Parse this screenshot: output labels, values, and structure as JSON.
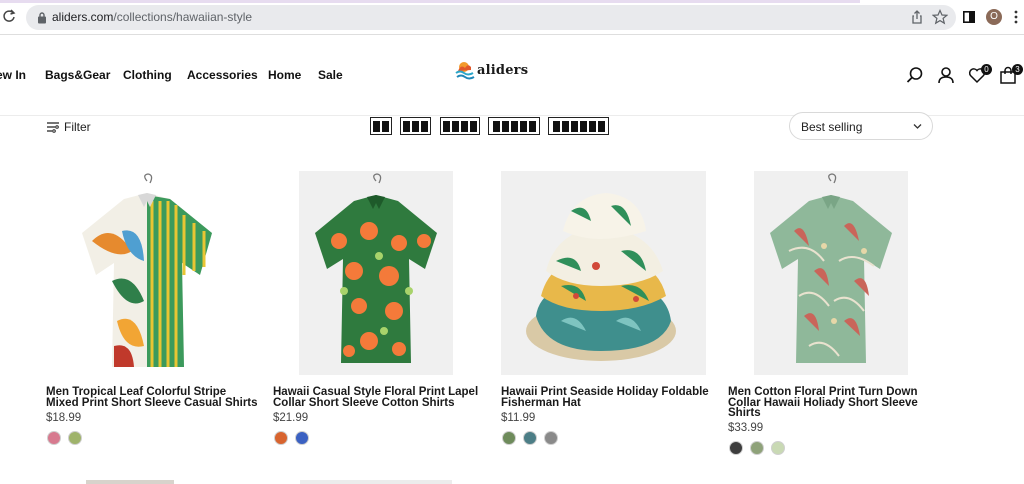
{
  "browser": {
    "url_domain": "aliders.com",
    "url_path": "/collections/hawaiian-style",
    "avatar_initial": "O"
  },
  "header": {
    "nav": [
      "ew In",
      "Bags&Gear",
      "Clothing",
      "Accessories",
      "Home",
      "Sale"
    ],
    "logo_text": "aliders",
    "wishlist_count": "0",
    "cart_count": "3"
  },
  "toolbar": {
    "filter_label": "Filter",
    "sort_label": "Best selling",
    "grid_options": [
      2,
      3,
      4,
      5,
      6
    ]
  },
  "products": [
    {
      "title_line1": "Men Tropical Leaf Colorful Stripe",
      "title_line2": "Mixed Print Short Sleeve Casual Shirts",
      "title_line3": "",
      "price": "$18.99",
      "swatch_colors": [
        "#d77a8f",
        "#9fb36b"
      ]
    },
    {
      "title_line1": "Hawaii Casual Style Floral Print Lapel",
      "title_line2": "Collar Short Sleeve Cotton Shirts",
      "title_line3": "",
      "price": "$21.99",
      "swatch_colors": [
        "#d8642f",
        "#3b61c2"
      ]
    },
    {
      "title_line1": "Hawaii Print Seaside Holiday Foldable",
      "title_line2": "Fisherman Hat",
      "title_line3": "",
      "price": "$11.99",
      "swatch_colors": [
        "#6e8b5b",
        "#4c7e86",
        "#8a8a8a"
      ]
    },
    {
      "title_line1": "Men Cotton Floral Print Turn Down",
      "title_line2": "Collar Hawaii Holiady Short Sleeve",
      "title_line3": "Shirts",
      "price": "$33.99",
      "swatch_colors": [
        "#3d3d3d",
        "#8fa27a",
        "#c9d9b4"
      ]
    }
  ],
  "colors": {
    "accent": "#111111",
    "image_bg": "#f0f0f0"
  }
}
